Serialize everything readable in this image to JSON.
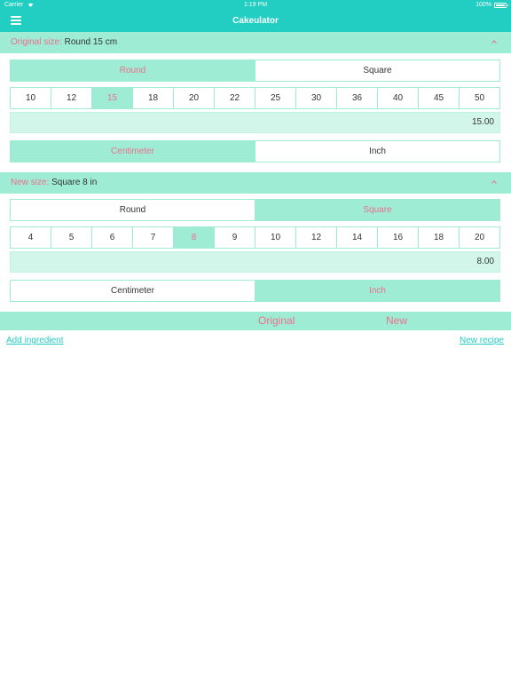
{
  "status": {
    "carrier": "Carrier",
    "time": "1:19 PM",
    "battery": "100%"
  },
  "app": {
    "title": "Cakeulator"
  },
  "original": {
    "label": "Original size:",
    "value": "Round 15 cm",
    "shapes": [
      {
        "label": "Round",
        "selected": true
      },
      {
        "label": "Square",
        "selected": false
      }
    ],
    "sizes": [
      "10",
      "12",
      "15",
      "18",
      "20",
      "22",
      "25",
      "30",
      "36",
      "40",
      "45",
      "50"
    ],
    "selected_size": "15",
    "amount": "15.00",
    "units": [
      {
        "label": "Centimeter",
        "selected": true
      },
      {
        "label": "Inch",
        "selected": false
      }
    ]
  },
  "newsize": {
    "label": "New size:",
    "value": "Square 8 in",
    "shapes": [
      {
        "label": "Round",
        "selected": false
      },
      {
        "label": "Square",
        "selected": true
      }
    ],
    "sizes": [
      "4",
      "5",
      "6",
      "7",
      "8",
      "9",
      "10",
      "12",
      "14",
      "16",
      "18",
      "20"
    ],
    "selected_size": "8",
    "amount": "8.00",
    "units": [
      {
        "label": "Centimeter",
        "selected": false
      },
      {
        "label": "Inch",
        "selected": true
      }
    ]
  },
  "columns": {
    "original": "Original",
    "new": "New"
  },
  "links": {
    "add_ingredient": "Add ingredient",
    "new_recipe": "New recipe"
  },
  "colors": {
    "teal": "#22cdc2",
    "mint": "#9fecd4",
    "pale_mint": "#d2f7ea",
    "pink": "#ee6f8f"
  },
  "icons": {
    "menu": "hamburger-menu-icon",
    "collapse": "chevron-up-icon",
    "wifi": "wifi-icon",
    "battery": "battery-icon"
  }
}
